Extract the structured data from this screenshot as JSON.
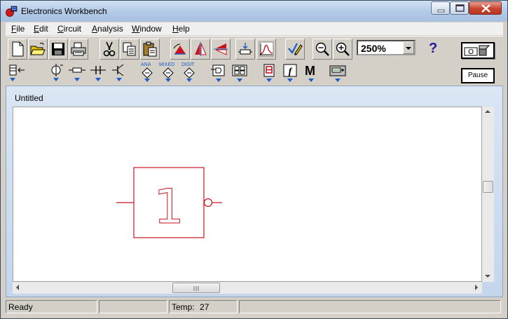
{
  "window": {
    "title": "Electronics Workbench"
  },
  "menu": {
    "items": [
      {
        "label": "File",
        "mnemonic": "F",
        "rest": "ile"
      },
      {
        "label": "Edit",
        "mnemonic": "E",
        "rest": "dit"
      },
      {
        "label": "Circuit",
        "mnemonic": "C",
        "rest": "ircuit"
      },
      {
        "label": "Analysis",
        "mnemonic": "A",
        "rest": "nalysis"
      },
      {
        "label": "Window",
        "mnemonic": "W",
        "rest": "indow"
      },
      {
        "label": "Help",
        "mnemonic": "H",
        "rest": "elp"
      }
    ]
  },
  "toolbar": {
    "zoom_value": "250%",
    "help_label": "?",
    "pause_label": "Pause",
    "parts_labels": {
      "analog": "ANA",
      "mixed": "MIXED",
      "digital": "DIGIT",
      "misc": "M"
    }
  },
  "document": {
    "title": "Untitled",
    "component_label": "1"
  },
  "statusbar": {
    "status": "Ready",
    "temp_label": "Temp:",
    "temp_value": "27"
  },
  "colors": {
    "component_red": "#c8141e",
    "accent_blue": "#1a5cc8",
    "titlebar": "#b2c9e6"
  }
}
